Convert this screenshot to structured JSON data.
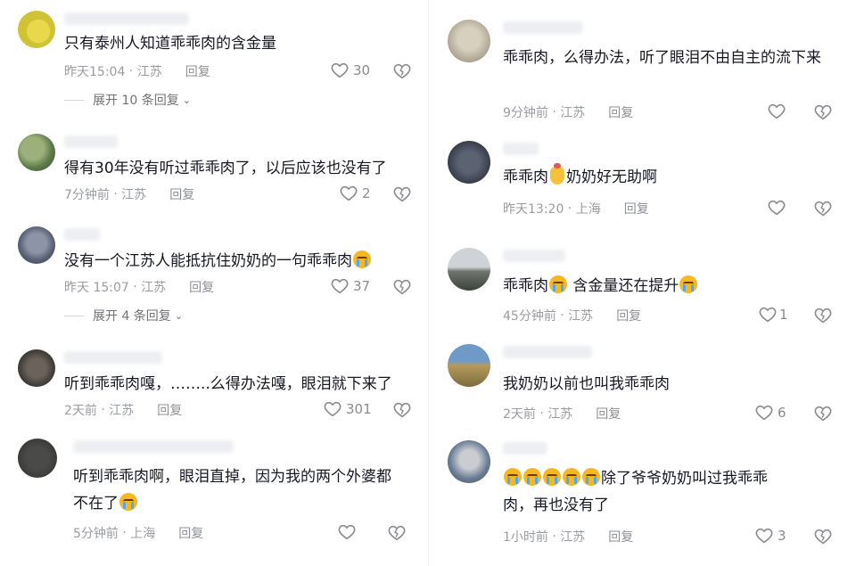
{
  "left": [
    {
      "text": "只有泰州人知道乖乖肉的含金量",
      "time": "昨天15:04",
      "region": "江苏",
      "reply": "回复",
      "likes": "30",
      "expand": "展开 10 条回复"
    },
    {
      "text": "得有30年没有听过乖乖肉了，以后应该也没有了",
      "time": "7分钟前",
      "region": "江苏",
      "reply": "回复",
      "likes": "2"
    },
    {
      "text": "没有一个江苏人能抵抗住奶奶的一句乖乖肉",
      "time": "昨天 15:07",
      "region": "江苏",
      "reply": "回复",
      "likes": "37",
      "expand": "展开 4 条回复"
    },
    {
      "text": "听到乖乖肉嘎，……..么得办法嘎，眼泪就下来了",
      "time": "2天前",
      "region": "江苏",
      "reply": "回复",
      "likes": "301"
    },
    {
      "text": "听到乖乖肉啊，眼泪直掉，因为我的两个外婆都不在了",
      "time": "5分钟前",
      "region": "上海",
      "reply": "回复",
      "likes": ""
    }
  ],
  "right": [
    {
      "text": "乖乖肉，么得办法，听了眼泪不由自主的流下来",
      "time": "9分钟前",
      "region": "江苏",
      "reply": "回复",
      "likes": ""
    },
    {
      "text_a": "乖乖肉",
      "text_b": "奶奶好无助啊",
      "time": "昨天13:20",
      "region": "上海",
      "reply": "回复",
      "likes": ""
    },
    {
      "text_a": "乖乖肉",
      "text_b": "含金量还在提升",
      "time": "45分钟前",
      "region": "江苏",
      "reply": "回复",
      "likes": "1"
    },
    {
      "text": "我奶奶以前也叫我乖乖肉",
      "time": "2天前",
      "region": "江苏",
      "reply": "回复",
      "likes": "6"
    },
    {
      "text_a": "除了爷爷奶奶叫过我乖乖",
      "text_b": "肉，再也没有了",
      "time": "1小时前",
      "region": "江苏",
      "reply": "回复",
      "likes": "3"
    }
  ],
  "icons": {
    "like": "heart-outline-icon",
    "dislike": "broken-heart-icon",
    "expand": "chevron-down-icon",
    "emoji": "crying-face-icon"
  },
  "colors": {
    "text": "#161823",
    "meta": "#9a9ca3",
    "icon": "#8a8b91"
  }
}
